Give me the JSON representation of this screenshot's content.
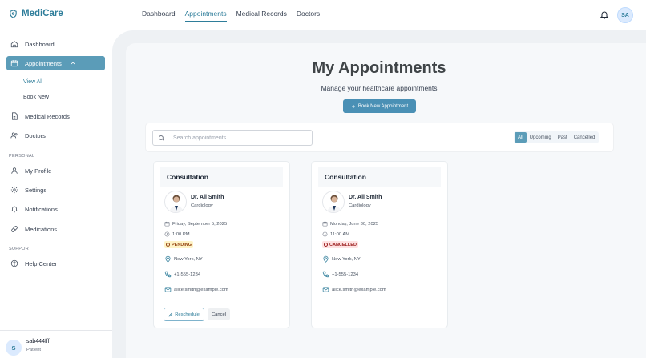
{
  "app": {
    "name": "MediCare"
  },
  "topnav": [
    {
      "label": "Dashboard",
      "active": false
    },
    {
      "label": "Appointments",
      "active": true
    },
    {
      "label": "Medical Records",
      "active": false
    },
    {
      "label": "Doctors",
      "active": false
    }
  ],
  "header": {
    "avatar_initials": "SA"
  },
  "sidebar": {
    "items": [
      {
        "label": "Dashboard",
        "icon": "home-icon"
      },
      {
        "label": "Appointments",
        "icon": "calendar-icon",
        "active": true
      },
      {
        "label": "Medical Records",
        "icon": "file-icon"
      },
      {
        "label": "Doctors",
        "icon": "users-icon"
      },
      {
        "label": "My Profile",
        "icon": "user-icon"
      },
      {
        "label": "Settings",
        "icon": "gear-icon"
      },
      {
        "label": "Notifications",
        "icon": "bell-icon"
      },
      {
        "label": "Medications",
        "icon": "pill-icon"
      },
      {
        "label": "Help Center",
        "icon": "help-icon"
      }
    ],
    "sub_items": [
      {
        "label": "View All",
        "active": true
      },
      {
        "label": "Book New",
        "active": false
      }
    ],
    "sections": {
      "personal": "PERSONAL",
      "support": "SUPPORT"
    },
    "user": {
      "initial": "S",
      "name": "sab444fff",
      "role": "Patient"
    }
  },
  "main": {
    "title": "My Appointments",
    "subtitle": "Manage your healthcare appointments",
    "book_button": "Book New Appointment",
    "search_placeholder": "Search appointments...",
    "filters": [
      {
        "label": "All",
        "active": true
      },
      {
        "label": "Upcoming",
        "active": false
      },
      {
        "label": "Past",
        "active": false
      },
      {
        "label": "Cancelled",
        "active": false
      }
    ]
  },
  "appointments": [
    {
      "type": "Consultation",
      "doctor": "Dr. Ali Smith",
      "specialty": "Cardiology",
      "date": "Friday, September 5, 2025",
      "time": "1:00 PM",
      "status": "PENDING",
      "location": "New York, NY",
      "phone": "+1-555-1234",
      "email": "alice.smith@example.com",
      "actions": {
        "reschedule": "Reschedule",
        "cancel": "Cancel"
      }
    },
    {
      "type": "Consultation",
      "doctor": "Dr. Ali Smith",
      "specialty": "Cardiology",
      "date": "Monday, June 30, 2025",
      "time": "11:00 AM",
      "status": "CANCELLED",
      "location": "New York, NY",
      "phone": "+1-555-1234",
      "email": "alice.smith@example.com"
    }
  ],
  "colors": {
    "brand": "#2e7d9a",
    "accent": "#5b9cb8",
    "button": "#4a90b5",
    "pending_bg": "#fef3c7",
    "cancelled_bg": "#fee2e2"
  }
}
